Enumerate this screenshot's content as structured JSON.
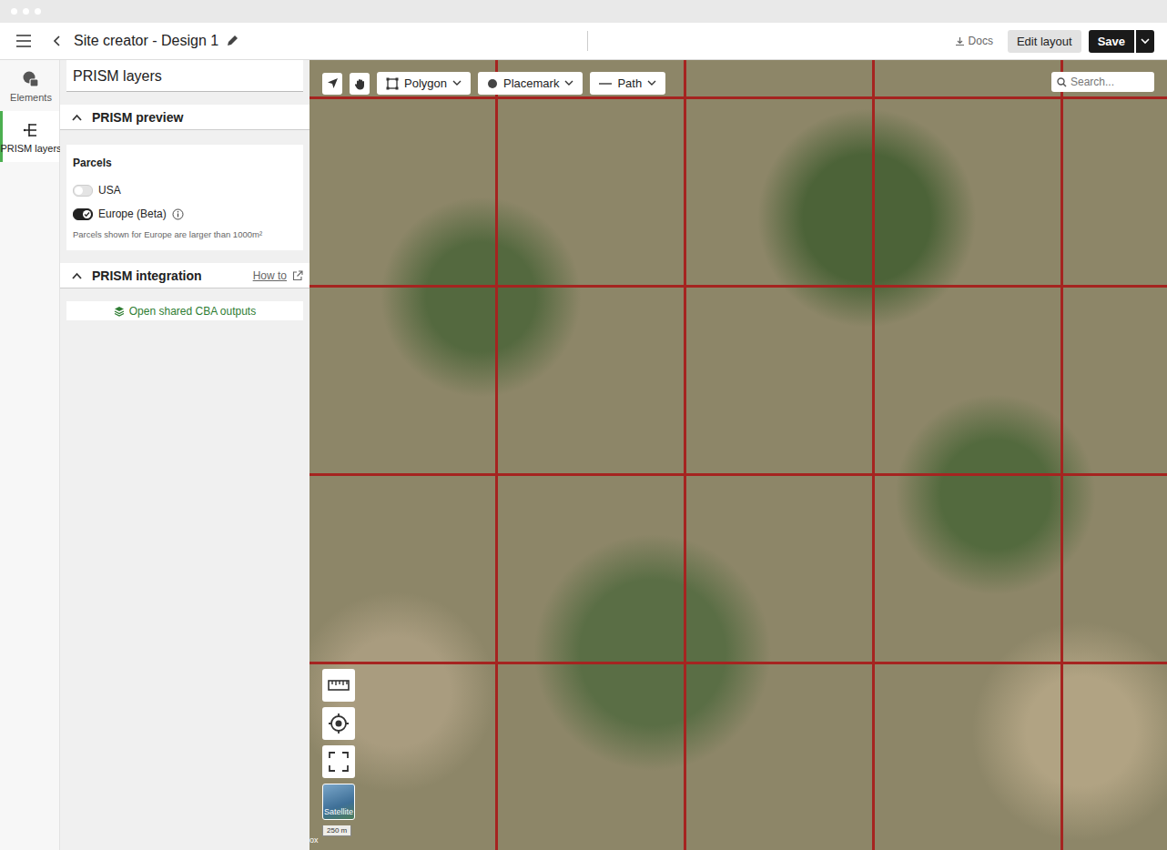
{
  "window": {
    "title": "Site creator - Design 1"
  },
  "header": {
    "docs": "Docs",
    "edit_layout": "Edit layout",
    "save": "Save"
  },
  "rail": [
    {
      "label": "Elements",
      "selected": false
    },
    {
      "label": "PRISM layers",
      "selected": true
    }
  ],
  "panel": {
    "title": "PRISM layers",
    "preview": {
      "title": "PRISM preview",
      "expanded": true,
      "group": "Parcels",
      "toggles": [
        {
          "label": "USA",
          "on": false,
          "info": false
        },
        {
          "label": "Europe (Beta)",
          "on": true,
          "info": true
        }
      ],
      "note": "Parcels shown for Europe are larger than 1000m²"
    },
    "integration": {
      "title": "PRISM integration",
      "expanded": true,
      "link": "How to",
      "button": "Open shared CBA outputs"
    }
  },
  "map": {
    "tools": [
      {
        "label": "Polygon",
        "kind": "polygon"
      },
      {
        "label": "Placemark",
        "kind": "placemark"
      },
      {
        "label": "Path",
        "kind": "path"
      }
    ],
    "search": {
      "placeholder": "Search..."
    },
    "basemap": "Satellite",
    "scale": "250 m",
    "attribution": "ox"
  }
}
